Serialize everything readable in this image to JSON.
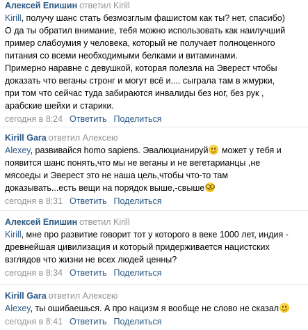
{
  "comments": [
    {
      "author": "Алексей Епишин",
      "replied": "ответил Kirill",
      "body_lines": [
        {
          "mention": "Kirill",
          "text": ", получу шанс стать безмозглым фашистом как ты? нет, спасибо)"
        },
        {
          "text": "О да ты обратил внимание, тебя можно использовать как наилучший"
        },
        {
          "text": "пример слабоумия у человека, который не получает полноценного"
        },
        {
          "text": "питания со всеми необходимыми белками и витаминами."
        },
        {
          "text": "Примерно наравне с девушкой, которая полезла на Эверест чтобы"
        },
        {
          "text": "доказать что веганы стронг и могут всё и.... сыграла там в жмурки,"
        },
        {
          "text": "при том что сейчас туда забираются инвалиды без ног, без рук ,"
        },
        {
          "text": "арабские шейхи и старики."
        }
      ],
      "time": "сегодня в 8:24",
      "reply_label": "Ответить",
      "share_label": "Поделиться"
    },
    {
      "author": "Kirill Gara",
      "replied": "ответил Алексею",
      "body_lines": [
        {
          "mention": "Alexey",
          "text": ", развивайся homo sapiens. Эвалюцианируй",
          "emoji": "smile",
          "tail": " может у тебя и"
        },
        {
          "text": "появится шанс понять,что мы не веганы и не вегетарианцы ,не"
        },
        {
          "text": "мясоеды и Эверест это не наша цель,чтобы что-то там"
        },
        {
          "text": "доказывать...есть вещи на порядок выше,-свыше",
          "emoji": "glasses"
        }
      ],
      "time": "сегодня в 8:31",
      "reply_label": "Ответить",
      "share_label": "Поделиться"
    },
    {
      "author": "Алексей Епишин",
      "replied": "ответил Kirill",
      "body_lines": [
        {
          "mention": "Kirill",
          "text": ", мне про развитие говорит тот у которого в веке 1000 лет, индия -"
        },
        {
          "text": "древнейшая цивилизация и который придерживается нацистских"
        },
        {
          "text": "взглядов что жизни не всех людей ценны?"
        }
      ],
      "time": "сегодня в 8:34",
      "reply_label": "Ответить",
      "share_label": "Поделиться"
    },
    {
      "author": "Kirill Gara",
      "replied": "ответил Алексею",
      "body_lines": [
        {
          "mention": "Alexey",
          "text": ", ты ошибаешься. А про нацизм я вообще не слово не сказал",
          "emoji": "smile"
        }
      ],
      "time": "сегодня в 8:41",
      "reply_label": "Ответить",
      "share_label": "Поделиться"
    }
  ],
  "colors": {
    "link": "#2a5885",
    "meta": "#939393",
    "divider": "#e7e8ec"
  }
}
